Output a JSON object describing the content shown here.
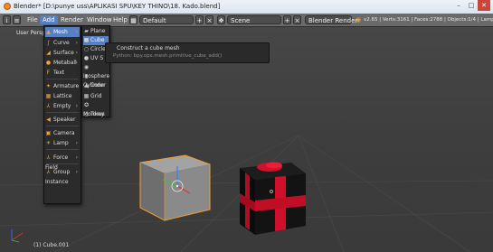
{
  "window": {
    "title": "Blender* [D:\\punye uss\\APLIKASI SPU\\KEY THINO\\18. Kado.blend]",
    "controls": [
      "–",
      "□",
      "✕"
    ]
  },
  "info_header": {
    "menus": [
      {
        "label": "File",
        "active": false
      },
      {
        "label": "Add",
        "active": true
      },
      {
        "label": "Render",
        "active": false
      },
      {
        "label": "Window",
        "active": false
      },
      {
        "label": "Help",
        "active": false
      }
    ],
    "layout_name": "Default",
    "scene_name": "Scene",
    "render_engine": "Blender Render",
    "stats": "v2.65 | Verts:3161 | Faces:2788 | Objects:1/4 | Lamp:0/1"
  },
  "viewport": {
    "view_label": "User Persp",
    "object_label": "(1) Cube.001"
  },
  "add_menu": {
    "items": [
      {
        "label": "Mesh",
        "icon": "mesh-icon",
        "has_submenu": true,
        "highlighted": true
      },
      {
        "label": "Curve",
        "icon": "curve-icon",
        "has_submenu": true,
        "highlighted": false
      },
      {
        "label": "Surface",
        "icon": "surface-icon",
        "has_submenu": true,
        "highlighted": false
      },
      {
        "label": "Metaball",
        "icon": "metaball-icon",
        "has_submenu": true,
        "highlighted": false
      },
      {
        "label": "Text",
        "icon": "text-icon",
        "has_submenu": false,
        "highlighted": false
      },
      {
        "label": "Armature",
        "icon": "armature-icon",
        "has_submenu": true,
        "highlighted": false
      },
      {
        "label": "Lattice",
        "icon": "lattice-icon",
        "has_submenu": false,
        "highlighted": false
      },
      {
        "label": "Empty",
        "icon": "empty-icon",
        "has_submenu": true,
        "highlighted": false
      },
      {
        "label": "Speaker",
        "icon": "speaker-icon",
        "has_submenu": false,
        "highlighted": false
      },
      {
        "label": "Camera",
        "icon": "camera-icon",
        "has_submenu": false,
        "highlighted": false
      },
      {
        "label": "Lamp",
        "icon": "lamp-icon",
        "has_submenu": true,
        "highlighted": false
      },
      {
        "label": "Force Field",
        "icon": "force-field-icon",
        "has_submenu": true,
        "highlighted": false
      },
      {
        "label": "Group Instance",
        "icon": "group-instance-icon",
        "has_submenu": true,
        "highlighted": false
      }
    ]
  },
  "mesh_submenu": {
    "items": [
      {
        "label": "Plane",
        "icon": "plane-icon",
        "highlighted": false
      },
      {
        "label": "Cube",
        "icon": "cube-icon",
        "highlighted": true
      },
      {
        "label": "Circle",
        "icon": "circle-icon",
        "highlighted": false
      },
      {
        "label": "UV S",
        "icon": "uv-sphere-icon",
        "highlighted": false
      },
      {
        "label": "Icosphere",
        "icon": "icosphere-icon",
        "highlighted": false
      },
      {
        "label": "Cylinder",
        "icon": "cylinder-icon",
        "highlighted": false
      },
      {
        "label": "Cone",
        "icon": "cone-icon",
        "highlighted": false
      },
      {
        "label": "Grid",
        "icon": "grid-icon",
        "highlighted": false
      },
      {
        "label": "Monkey",
        "icon": "monkey-icon",
        "highlighted": false
      },
      {
        "label": "Torus",
        "icon": "torus-icon",
        "highlighted": false
      }
    ]
  },
  "tooltip": {
    "title": "Construct a cube mesh",
    "python": "Python: bpy.ops.mesh.primitive_cube_add()"
  },
  "colors": {
    "accent": "#5680c2",
    "menu_bg": "#2b2b2b",
    "gift_body": "#111111",
    "gift_ribbon": "#d0102a",
    "cube_face": "#8a8a8a",
    "selection_outline": "#f0a030"
  }
}
